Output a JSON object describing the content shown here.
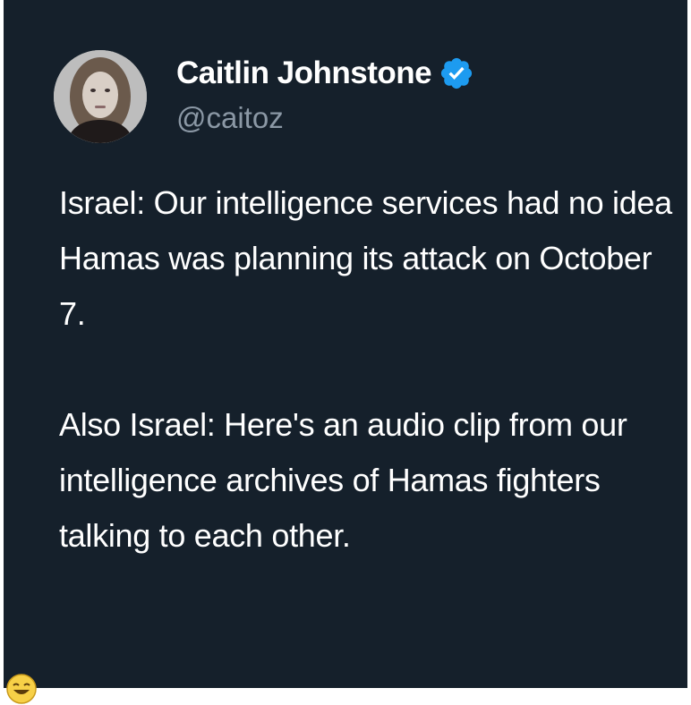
{
  "author": {
    "display_name": "Caitlin Johnstone",
    "handle": "@caitoz",
    "verified_icon": "verified-badge-icon",
    "avatar_icon": "profile-photo"
  },
  "tweet": {
    "paragraphs": [
      "Israel: Our intelligence services had no idea Hamas was planning its attack on October 7.",
      "Also Israel: Here's an audio clip from our intelligence archives of Hamas fighters talking to each other."
    ]
  },
  "reaction_icon": "laughing-emoji-icon",
  "colors": {
    "card_background": "#15202b",
    "text_primary": "#ffffff",
    "text_secondary": "#8b98a5",
    "verified_blue": "#1d9bf0"
  }
}
